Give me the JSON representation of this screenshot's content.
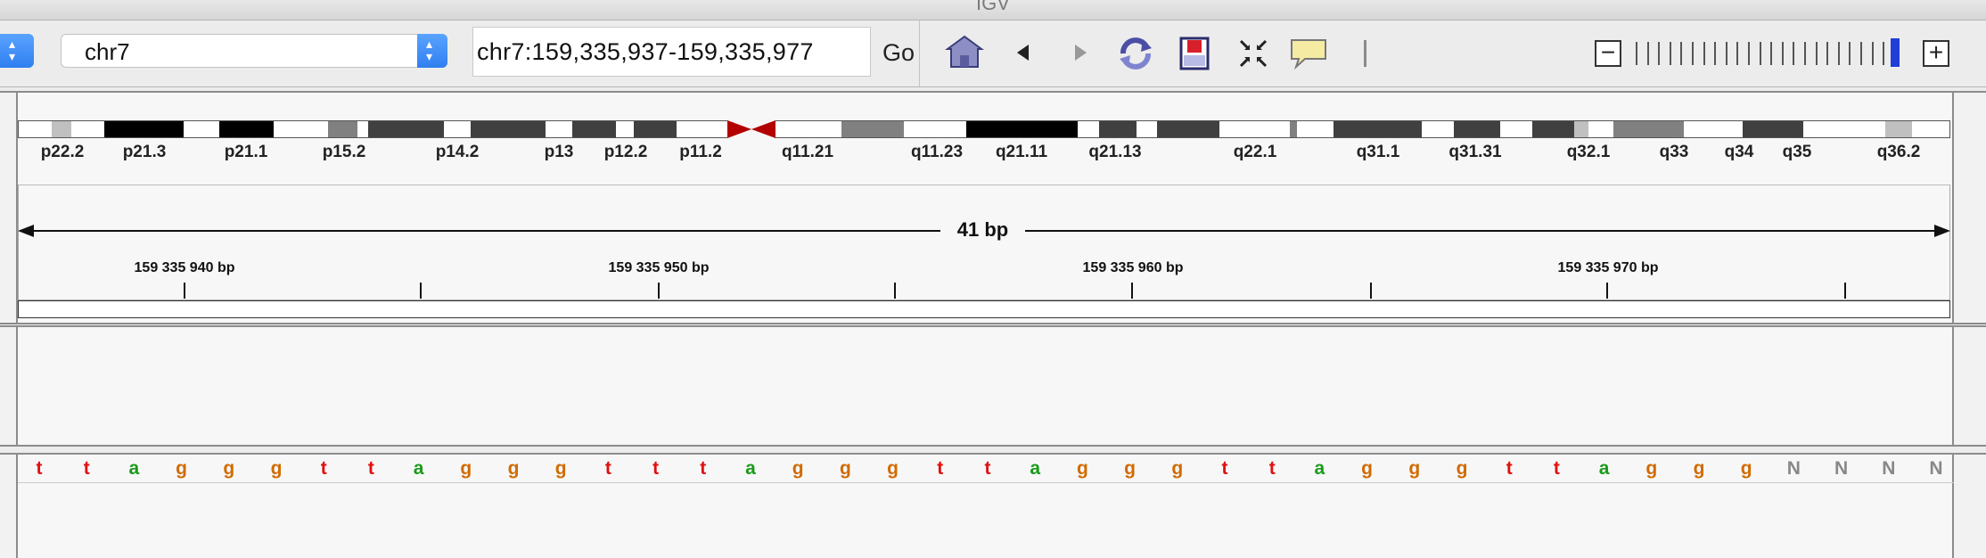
{
  "window": {
    "title": "IGV"
  },
  "toolbar": {
    "genome_value": "",
    "chromosome_value": "chr7",
    "locus_value": "chr7:159,335,937-159,335,977",
    "go_label": "Go",
    "icons": [
      "home-icon",
      "back-icon",
      "forward-icon",
      "refresh-icon",
      "region-of-interest-icon",
      "fit-to-window-icon",
      "popup-info-icon"
    ],
    "zoom_out_label": "−",
    "zoom_in_label": "+",
    "zoom_ticks": 24,
    "zoom_level": 23,
    "colors": {
      "select_accent": "#2f7ff0",
      "zoom_knob": "#1f3fd8"
    }
  },
  "ideogram": {
    "band_labels": [
      "p22.2",
      "p21.3",
      "p21.1",
      "p15.2",
      "p14.2",
      "p13",
      "p12.2",
      "p11.2",
      "q11.21",
      "q11.23",
      "q21.11",
      "q21.13",
      "q22.1",
      "q31.1",
      "q31.31",
      "q32.1",
      "q33",
      "q34",
      "q35",
      "q36.2"
    ],
    "centromere_color": "#b30000"
  },
  "ruler": {
    "span_label": "41 bp",
    "tick_labels": [
      "159 335 940 bp",
      "159 335 950 bp",
      "159 335 960 bp",
      "159 335 970 bp"
    ]
  },
  "sequence": {
    "bases": [
      "t",
      "t",
      "a",
      "g",
      "g",
      "g",
      "t",
      "t",
      "a",
      "g",
      "g",
      "g",
      "t",
      "t",
      "t",
      "a",
      "g",
      "g",
      "g",
      "t",
      "t",
      "a",
      "g",
      "g",
      "g",
      "t",
      "t",
      "a",
      "g",
      "g",
      "g",
      "t",
      "t",
      "a",
      "g",
      "g",
      "g",
      "N",
      "N",
      "N",
      "N"
    ],
    "colors": {
      "t": "#e01010",
      "a": "#1a9a1a",
      "g": "#d16b00",
      "N": "#888888"
    }
  }
}
